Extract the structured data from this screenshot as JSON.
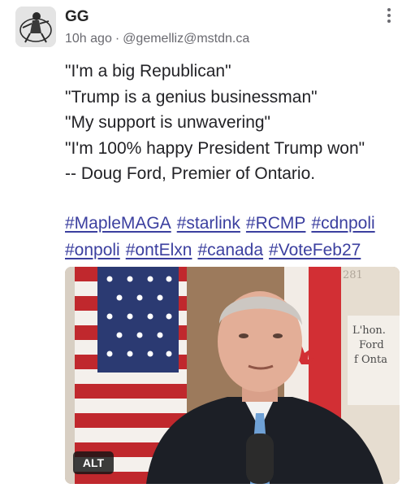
{
  "author": {
    "display_name": "GG",
    "relative_time": "10h ago",
    "separator": "·",
    "handle": "@gemelliz@mstdn.ca",
    "avatar_icon": "avatar-icon"
  },
  "more_menu_icon": "more-vertical-icon",
  "content_lines": [
    "\"I'm a big Republican\"",
    "\"Trump is a genius businessman\"",
    "\"My support is unwavering\"",
    "\"I'm 100% happy President Trump won\"",
    "-- Doug Ford, Premier of Ontario."
  ],
  "hashtags": [
    "#MapleMAGA",
    "#starlink",
    "#RCMP",
    "#cdnpoli",
    "#onpoli",
    "#ontElxn",
    "#canada",
    "#VoteFeb27"
  ],
  "media": {
    "alt_badge": "ALT",
    "sign_lines": [
      "L'hon.",
      "Ford",
      "f Onta"
    ],
    "sign_number": "281"
  },
  "colors": {
    "hashtag": "#3b3f9f",
    "meta_text": "#6a6a70",
    "alt_badge_bg": "#141414"
  }
}
